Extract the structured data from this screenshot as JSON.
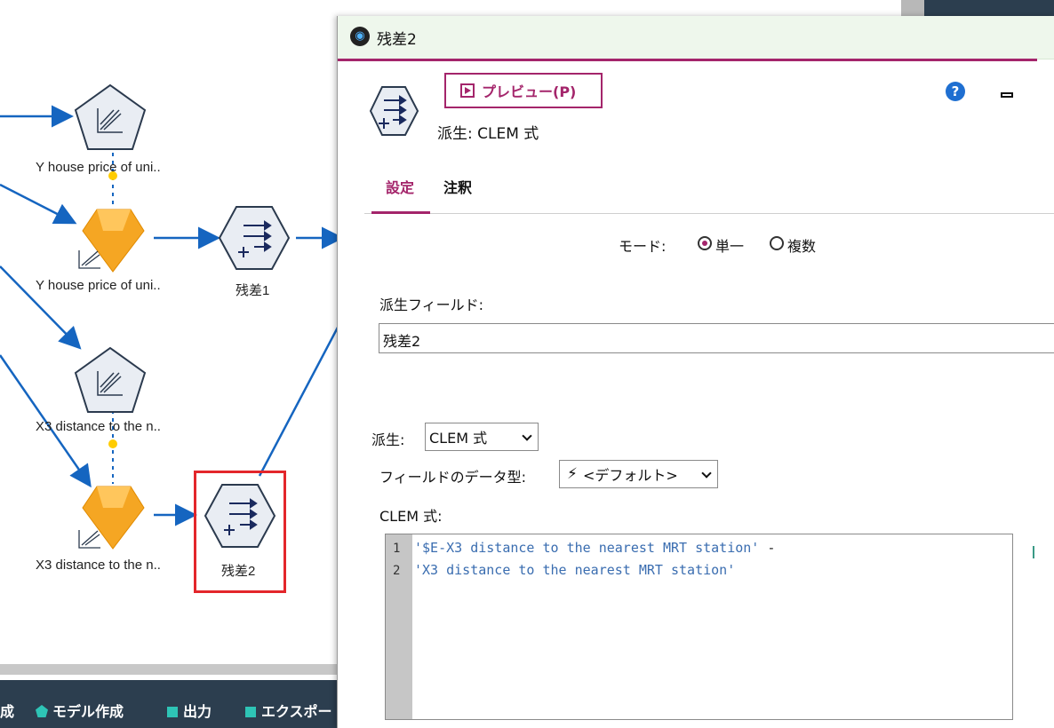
{
  "canvas": {
    "nodes": [
      {
        "label": "Y house price of uni..",
        "kind": "graph-node"
      },
      {
        "label": "Y house price of uni..",
        "kind": "model-nugget"
      },
      {
        "label": "残差1",
        "kind": "derive-node"
      },
      {
        "label": "X3 distance to the n..",
        "kind": "graph-node"
      },
      {
        "label": "X3 distance to the n..",
        "kind": "model-nugget"
      },
      {
        "label": "残差2",
        "kind": "derive-node",
        "selected": true
      }
    ],
    "palette": [
      {
        "label": "成",
        "icon": "square-icon"
      },
      {
        "label": "モデル作成",
        "icon": "pentagon-icon"
      },
      {
        "label": "出力",
        "icon": "square-icon"
      },
      {
        "label": "エクスポー",
        "icon": "square-icon"
      }
    ],
    "colors": {
      "accent": "#1565c0",
      "palette_bg": "#2c3e4f",
      "palette_icon": "#2ec4b6",
      "selection": "#e3262b"
    }
  },
  "dialog": {
    "title": "残差2",
    "preview_label": "プレビュー(P)",
    "node_type": "派生: CLEM 式",
    "help_glyph": "?",
    "tabs": [
      {
        "label": "設定",
        "active": true
      },
      {
        "label": "注釈",
        "active": false
      }
    ],
    "mode": {
      "label": "モード:",
      "options": [
        {
          "label": "単一",
          "selected": true
        },
        {
          "label": "複数",
          "selected": false
        }
      ]
    },
    "derive_field": {
      "label": "派生フィールド:",
      "value": "残差2"
    },
    "derive_as": {
      "label": "派生:",
      "value": "CLEM 式"
    },
    "field_type": {
      "label": "フィールドのデータ型:",
      "value": "<デフォルト>"
    },
    "clem": {
      "label": "CLEM 式:",
      "lines": [
        {
          "number": "1",
          "text": "'$E-X3 distance to the nearest MRT station'",
          "op": " -"
        },
        {
          "number": "2",
          "text": "'X3 distance to the nearest MRT station'",
          "op": ""
        }
      ]
    },
    "colors": {
      "accent": "#a4256b",
      "title_bg": "#eef7ec",
      "help": "#1f6fd1",
      "code": "#3a6db0"
    }
  }
}
